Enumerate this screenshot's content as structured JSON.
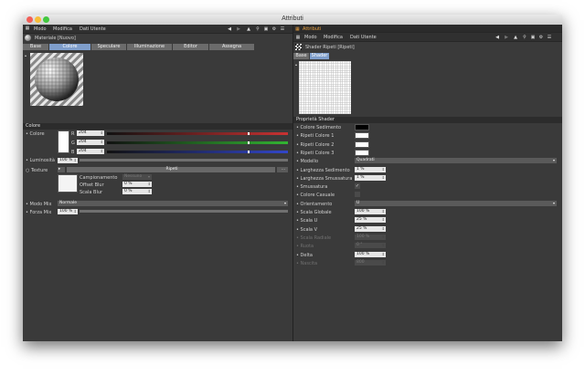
{
  "window": {
    "title": "Attributi"
  },
  "left": {
    "menu": [
      "Modo",
      "Modifica",
      "Dati Utente"
    ],
    "material_name": "Materiale [Nuovo]",
    "tabs": [
      {
        "label": "Base"
      },
      {
        "label": "Colore",
        "active": true
      },
      {
        "label": "Speculare"
      },
      {
        "label": "Illuminazione"
      },
      {
        "label": "Editor"
      },
      {
        "label": "Assegna"
      }
    ],
    "section_colore": "Colore",
    "colore_label": "Colore",
    "channels": [
      {
        "label": "R",
        "value": "204",
        "color": "#c83232",
        "pos": 0.78
      },
      {
        "label": "G",
        "value": "204",
        "color": "#32b432",
        "pos": 0.78
      },
      {
        "label": "B",
        "value": "204",
        "color": "#3246c8",
        "pos": 0.78
      }
    ],
    "luminosita_label": "Luminosità",
    "luminosita_value": "100 %",
    "texture_label": "Texture",
    "texture_name": "Ripeti",
    "texture_more": "...",
    "campionamento_label": "Campionamento",
    "campionamento_value": "Nessuno",
    "offset_blur_label": "Offset Blur",
    "offset_blur_value": "0 %",
    "scala_blur_label": "Scala Blur",
    "scala_blur_value": "0 %",
    "modo_mix_label": "Modo Mix",
    "modo_mix_value": "Normale",
    "forza_mix_label": "Forza Mix",
    "forza_mix_value": "100 %"
  },
  "right": {
    "menu_top": "Attributi",
    "menu": [
      "Modo",
      "Modifica",
      "Dati Utente"
    ],
    "shader_name": "Shader Ripeti [Ripeti]",
    "tabs": [
      {
        "label": "Base"
      },
      {
        "label": "Shader",
        "active": true
      }
    ],
    "section": "Proprietà Shader",
    "props": [
      {
        "label": "Colore Sedimento",
        "type": "swatch",
        "color": "#000000"
      },
      {
        "label": "Ripeti Colore 1",
        "type": "swatch",
        "color": "#ffffff"
      },
      {
        "label": "Ripeti Colore 2",
        "type": "swatch",
        "color": "#ffffff"
      },
      {
        "label": "Ripeti Colore 3",
        "type": "swatch",
        "color": "#ffffff"
      },
      {
        "label": "Modello",
        "type": "dropdown",
        "value": "Quadrati"
      },
      {
        "label": "Larghezza Sedimento",
        "type": "field",
        "value": "1 %"
      },
      {
        "label": "Larghezza Smussatura",
        "type": "field",
        "value": "1 %"
      },
      {
        "label": "Smussatura",
        "type": "check",
        "value": "✓"
      },
      {
        "label": "Colore Casuale",
        "type": "check",
        "value": ""
      },
      {
        "label": "Orientamento",
        "type": "dropdown",
        "value": "U"
      },
      {
        "label": "Scala Globale",
        "type": "field",
        "value": "100 %"
      },
      {
        "label": "Scala U",
        "type": "field",
        "value": "25 %"
      },
      {
        "label": "Scala V",
        "type": "field",
        "value": "25 %"
      },
      {
        "label": "Scala Radiale",
        "type": "field",
        "value": "100 %",
        "disabled": true
      },
      {
        "label": "Ruota",
        "type": "field",
        "value": "0 °",
        "disabled": true
      },
      {
        "label": "Delta",
        "type": "field",
        "value": "100 %"
      },
      {
        "label": "Nascita",
        "type": "field",
        "value": "800",
        "disabled": true
      }
    ]
  }
}
